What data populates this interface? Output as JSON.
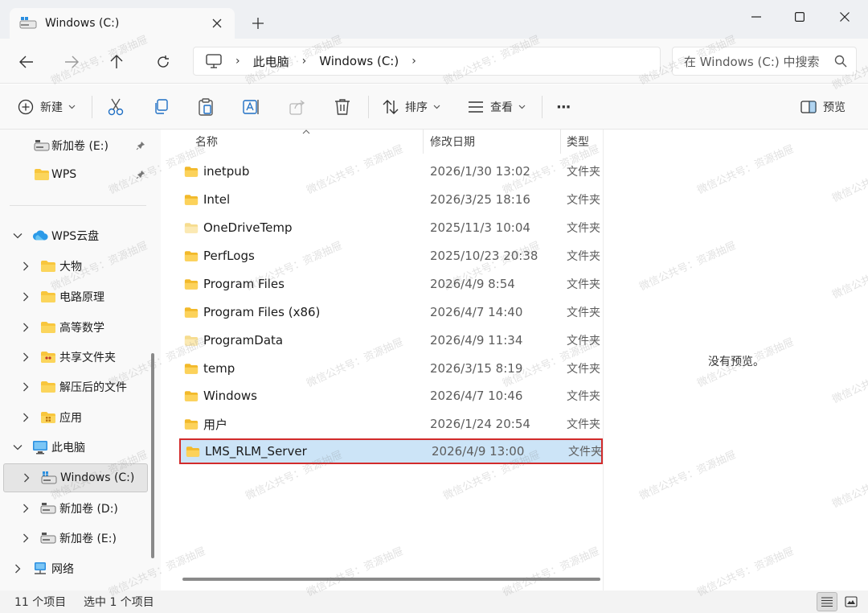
{
  "window": {
    "tab_title": "Windows (C:)"
  },
  "address": {
    "crumbs": [
      "此电脑",
      "Windows (C:)"
    ],
    "search_placeholder": "在 Windows (C:) 中搜索"
  },
  "toolbar": {
    "new_label": "新建",
    "sort_label": "排序",
    "view_label": "查看",
    "more_label": "···",
    "preview_label": "预览"
  },
  "sidebar": {
    "items": [
      {
        "label": "新加卷 (E:)",
        "icon": "drive-icon",
        "pinned": true
      },
      {
        "label": "WPS",
        "icon": "folder-icon",
        "pinned": true
      },
      {
        "label": "WPS云盘",
        "icon": "cloud-icon"
      },
      {
        "label": "大物",
        "icon": "folder-icon"
      },
      {
        "label": "电路原理",
        "icon": "folder-icon"
      },
      {
        "label": "高等数学",
        "icon": "folder-icon"
      },
      {
        "label": "共享文件夹",
        "icon": "shared-folder-icon"
      },
      {
        "label": "解压后的文件",
        "icon": "folder-icon"
      },
      {
        "label": "应用",
        "icon": "apps-folder-icon"
      },
      {
        "label": "此电脑",
        "icon": "pc-icon"
      },
      {
        "label": "Windows (C:)",
        "icon": "windows-drive-icon",
        "selected": true
      },
      {
        "label": "新加卷 (D:)",
        "icon": "drive-icon"
      },
      {
        "label": "新加卷 (E:)",
        "icon": "drive-icon"
      },
      {
        "label": "网络",
        "icon": "network-icon"
      }
    ]
  },
  "filelist": {
    "columns": {
      "name": "名称",
      "date": "修改日期",
      "type": "类型"
    },
    "rows": [
      {
        "name": "inetpub",
        "date": "2026/1/30 13:02",
        "type": "文件夹"
      },
      {
        "name": "Intel",
        "date": "2026/3/25 18:16",
        "type": "文件夹"
      },
      {
        "name": "OneDriveTemp",
        "date": "2025/11/3 10:04",
        "type": "文件夹"
      },
      {
        "name": "PerfLogs",
        "date": "2025/10/23 20:38",
        "type": "文件夹"
      },
      {
        "name": "Program Files",
        "date": "2026/4/9 8:54",
        "type": "文件夹"
      },
      {
        "name": "Program Files (x86)",
        "date": "2026/4/7 14:40",
        "type": "文件夹"
      },
      {
        "name": "ProgramData",
        "date": "2026/4/9 11:34",
        "type": "文件夹"
      },
      {
        "name": "temp",
        "date": "2026/3/15 8:19",
        "type": "文件夹"
      },
      {
        "name": "Windows",
        "date": "2026/4/7 10:46",
        "type": "文件夹"
      },
      {
        "name": "用户",
        "date": "2026/1/24 20:54",
        "type": "文件夹"
      },
      {
        "name": "LMS_RLM_Server",
        "date": "2026/4/9 13:00",
        "type": "文件夹",
        "selected": true
      }
    ]
  },
  "preview": {
    "empty_text": "没有预览。"
  },
  "status": {
    "item_count": "11 个项目",
    "selected_count": "选中 1 个项目"
  },
  "watermark": "微信公共号：资源抽屉",
  "colors": {
    "accent_selection": "#cce4f7",
    "highlight_border": "#d22b2b",
    "folder_yellow": "#f8c63d"
  }
}
